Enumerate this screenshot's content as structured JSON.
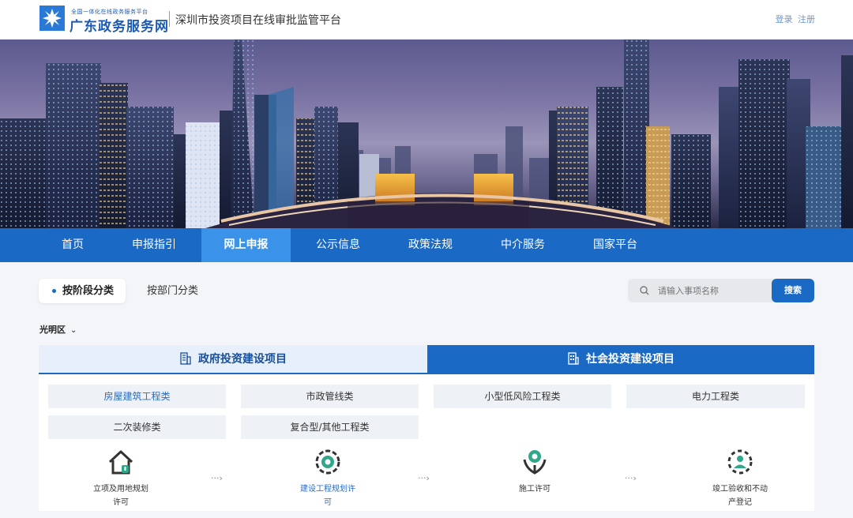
{
  "header": {
    "logo_small": "全国一体化在线政务服务平台",
    "logo_main": "广东政务服务网",
    "platform_title": "深圳市投资项目在线审批监管平台",
    "login": "登录",
    "register": "注册"
  },
  "nav": {
    "items": [
      "首页",
      "申报指引",
      "网上申报",
      "公示信息",
      "政策法规",
      "中介服务",
      "国家平台"
    ],
    "active": "网上申报"
  },
  "filters": {
    "tab_stage": "按阶段分类",
    "tab_department": "按部门分类",
    "search_placeholder": "请输入事项名称",
    "search_button": "搜索",
    "district": "光明区"
  },
  "panel": {
    "tab_gov": "政府投资建设项目",
    "tab_social": "社会投资建设项目",
    "categories": [
      "房屋建筑工程类",
      "市政管线类",
      "小型低风险工程类",
      "电力工程类",
      "二次装修类",
      "复合型/其他工程类"
    ],
    "active_category": "房屋建筑工程类",
    "steps": [
      {
        "line1": "立项及用地规划",
        "line2": "许可",
        "icon": "house-icon"
      },
      {
        "line1": "建设工程规划许",
        "line2": "可",
        "icon": "gear-badge-icon"
      },
      {
        "line1": "施工许可",
        "line2": "",
        "icon": "construction-icon"
      },
      {
        "line1": "竣工验收和不动",
        "line2": "产登记",
        "icon": "inspection-icon"
      }
    ],
    "arrow_glyph": "···›"
  },
  "colors": {
    "brand_blue": "#1a69c4",
    "nav_active": "#3a93e8",
    "link_blue": "#2d6cc0",
    "icon_green": "#2fa78a"
  }
}
